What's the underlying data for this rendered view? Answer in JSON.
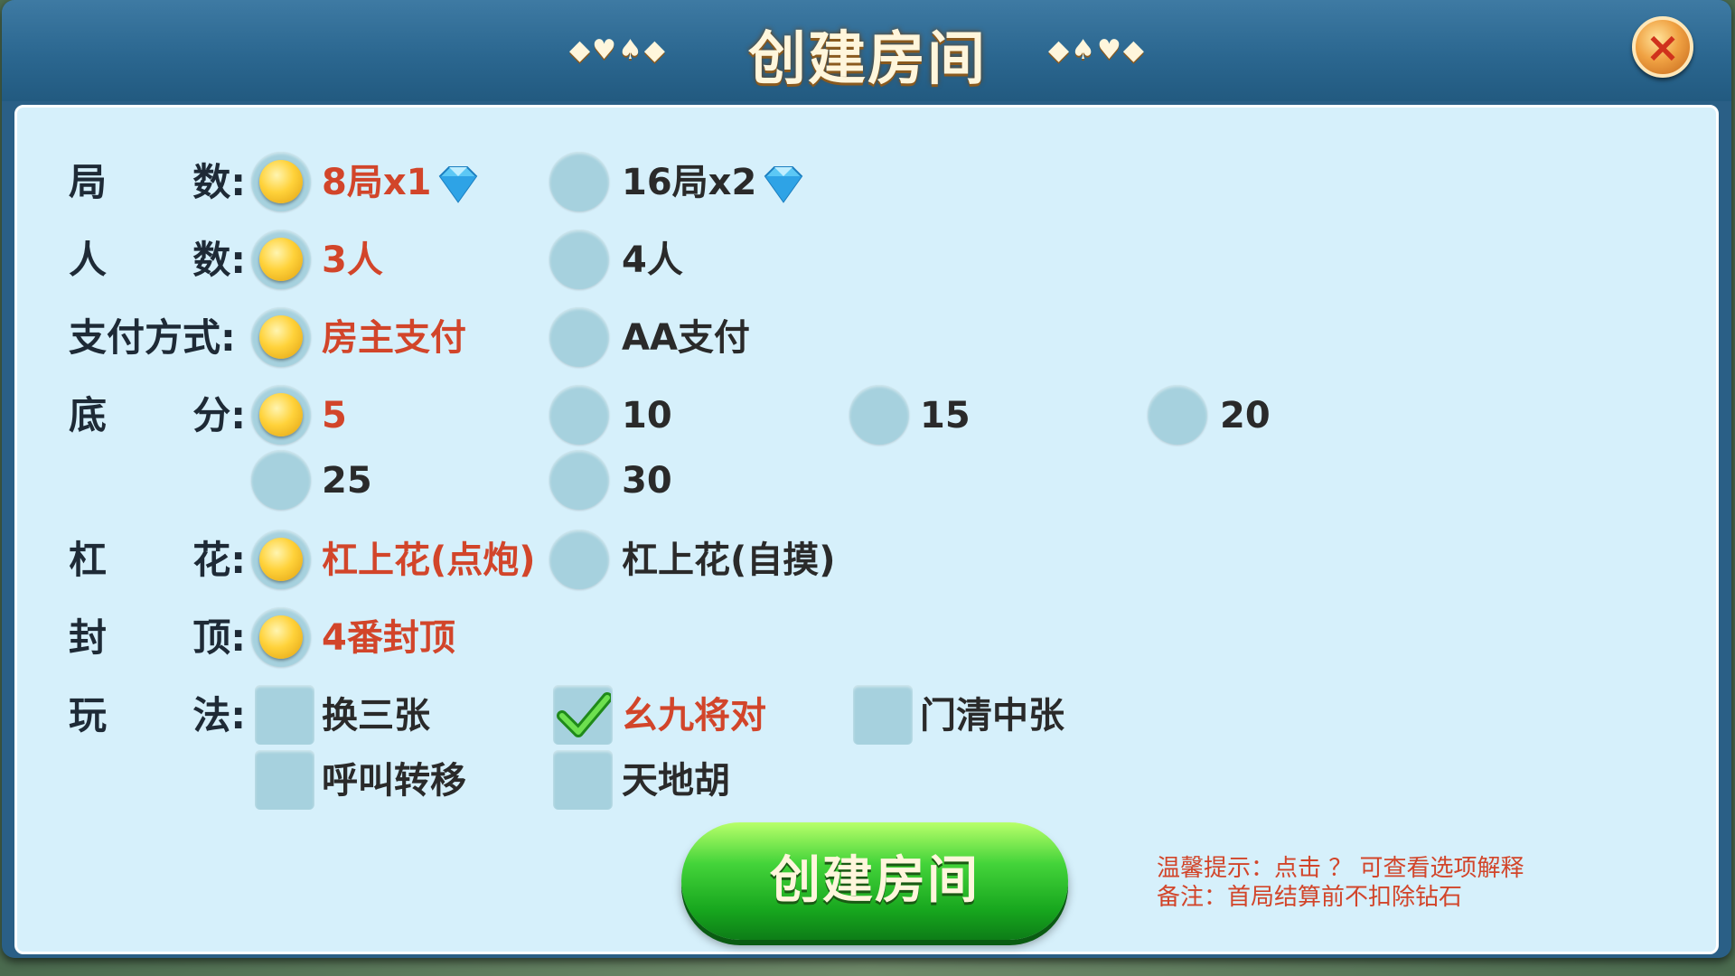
{
  "dialog": {
    "title": "创建房间",
    "deco_left": "◆♥♠◆",
    "deco_right": "◆♠♥◆",
    "close_label": "×"
  },
  "rows": {
    "rounds": {
      "label_a": "局",
      "label_b": "数:",
      "options": [
        "8局x1",
        "16局x2"
      ],
      "selected": 0
    },
    "players": {
      "label_a": "人",
      "label_b": "数:",
      "options": [
        "3人",
        "4人"
      ],
      "selected": 0
    },
    "payment": {
      "label_a": "支付方式:",
      "label_b": "",
      "options": [
        "房主支付",
        "AA支付"
      ],
      "selected": 0
    },
    "base_score": {
      "label_a": "底",
      "label_b": "分:",
      "options": [
        "5",
        "10",
        "15",
        "20",
        "25",
        "30"
      ],
      "selected": 0
    },
    "gang_hua": {
      "label_a": "杠",
      "label_b": "花:",
      "options": [
        "杠上花(点炮)",
        "杠上花(自摸)"
      ],
      "selected": 0
    },
    "cap": {
      "label_a": "封",
      "label_b": "顶:",
      "options": [
        "4番封顶"
      ],
      "selected": 0
    },
    "rules": {
      "label_a": "玩",
      "label_b": "法:",
      "options": [
        "换三张",
        "幺九将对",
        "门清中张",
        "呼叫转移",
        "天地胡"
      ],
      "checked": [
        false,
        true,
        false,
        false,
        false
      ]
    }
  },
  "create_button": "创建房间",
  "tips": {
    "line1": "温馨提示：点击 ？ 可查看选项解释",
    "line2": "备注：首局结算前不扣除钻石"
  },
  "colors": {
    "selected_text": "#d2452a",
    "panel": "#d6f0fb",
    "title_bar": "#2b6790"
  }
}
